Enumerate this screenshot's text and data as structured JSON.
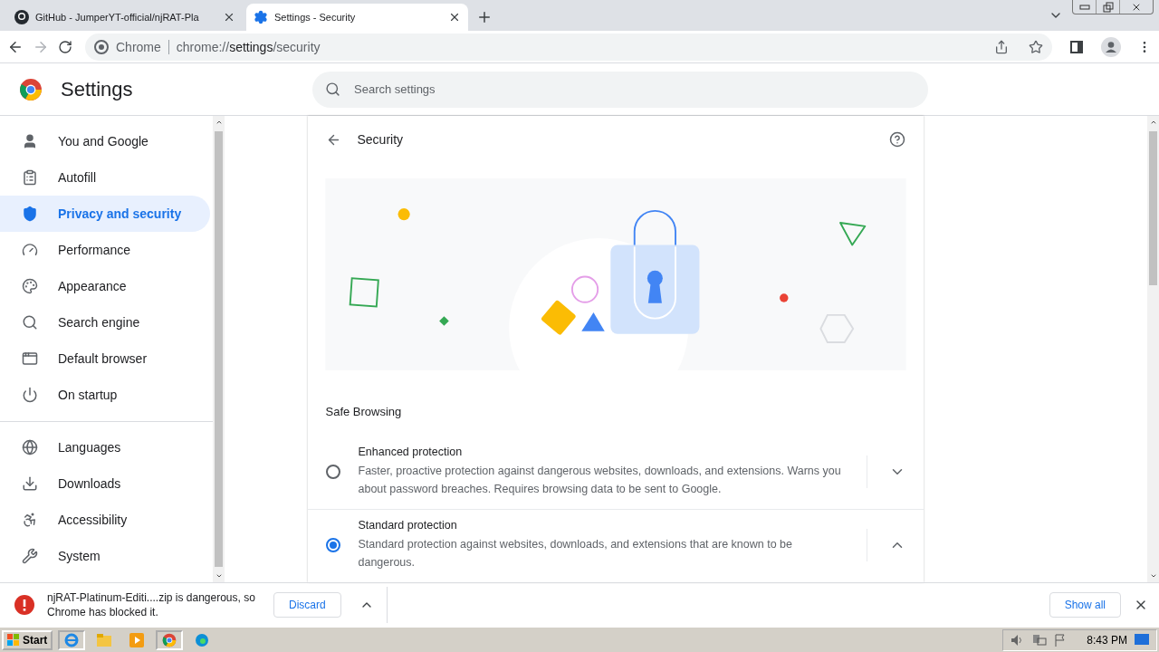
{
  "browser_tabs": [
    {
      "title": "GitHub - JumperYT-official/njRAT-Pla",
      "selected": false
    },
    {
      "title": "Settings - Security",
      "selected": true
    }
  ],
  "address_bar": {
    "site": "Chrome",
    "url_prefix": "chrome://",
    "url_host": "settings",
    "url_path": "/security"
  },
  "settings_header": {
    "title": "Settings",
    "search": {
      "placeholder": "Search settings"
    }
  },
  "sidebar": {
    "groups": [
      [
        {
          "label": "You and Google",
          "selected": false
        },
        {
          "label": "Autofill",
          "selected": false
        },
        {
          "label": "Privacy and security",
          "selected": true
        },
        {
          "label": "Performance",
          "selected": false
        },
        {
          "label": "Appearance",
          "selected": false
        },
        {
          "label": "Search engine",
          "selected": false
        },
        {
          "label": "Default browser",
          "selected": false
        },
        {
          "label": "On startup",
          "selected": false
        }
      ],
      [
        {
          "label": "Languages",
          "selected": false
        },
        {
          "label": "Downloads",
          "selected": false
        },
        {
          "label": "Accessibility",
          "selected": false
        },
        {
          "label": "System",
          "selected": false
        }
      ]
    ]
  },
  "page": {
    "title": "Security",
    "section_title": "Safe Browsing",
    "options": [
      {
        "title": "Enhanced protection",
        "description": "Faster, proactive protection against dangerous websites, downloads, and extensions. Warns you about password breaches. Requires browsing data to be sent to Google.",
        "selected": false,
        "expanded": false
      },
      {
        "title": "Standard protection",
        "description": "Standard protection against websites, downloads, and extensions that are known to be dangerous.",
        "selected": true,
        "expanded": true
      }
    ]
  },
  "download_bar": {
    "message": "njRAT-Platinum-Editi....zip is dangerous, so Chrome has blocked it.",
    "discard_button": "Discard",
    "show_all_button": "Show all"
  },
  "taskbar": {
    "start_button": "Start",
    "clock": "8:43 PM"
  }
}
